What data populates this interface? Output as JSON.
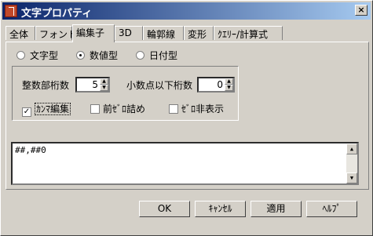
{
  "window": {
    "title": "文字プロパティ",
    "close_glyph": "×"
  },
  "tabs": [
    "全体",
    "フォント",
    "編集子",
    "3D",
    "輪郭線",
    "変形",
    "ｸｴﾘｰ/計算式"
  ],
  "active_tab": "編集子",
  "data_type": {
    "options": [
      "文字型",
      "数値型",
      "日付型"
    ],
    "selected": "数値型"
  },
  "numeric": {
    "integer_digits_label": "整数部桁数",
    "integer_digits_value": "5",
    "decimal_digits_label": "小数点以下桁数",
    "decimal_digits_value": "0"
  },
  "checkboxes": [
    {
      "label": "ｶﾝﾏ編集",
      "checked": true,
      "check_glyph": "✓"
    },
    {
      "label": "前ｾﾞﾛ詰め",
      "checked": false,
      "check_glyph": ""
    },
    {
      "label": "ｾﾞﾛ非表示",
      "checked": false,
      "check_glyph": ""
    }
  ],
  "format_text": "##,##0",
  "spin_up": "▲",
  "spin_down": "▼",
  "buttons": {
    "ok": "OK",
    "cancel": "ｷｬﾝｾﾙ",
    "apply": "適用",
    "help": "ﾍﾙﾌﾟ"
  }
}
